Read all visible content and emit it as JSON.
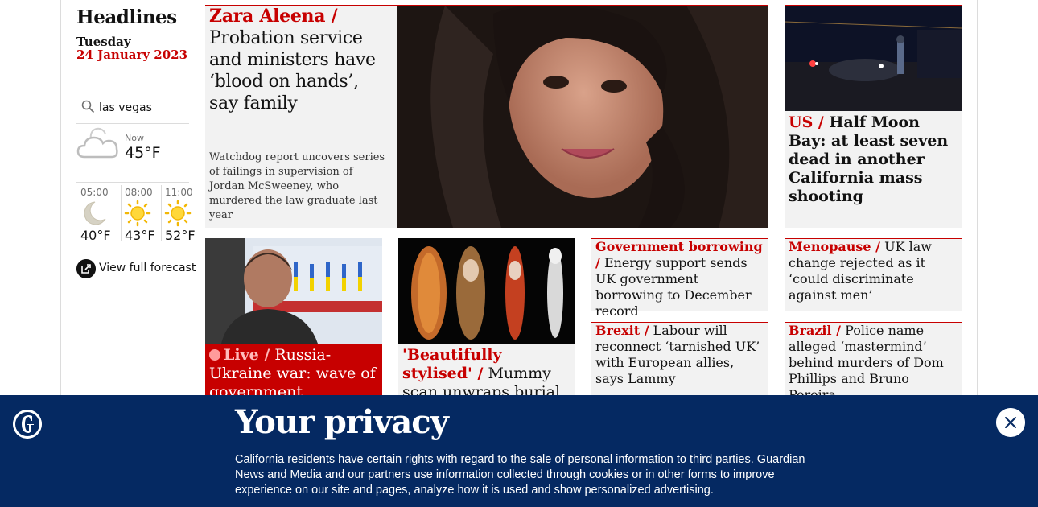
{
  "sidebar": {
    "section_title": "Headlines",
    "day": "Tuesday",
    "date": "24 January 2023",
    "search_value": "las vegas",
    "weather_now_label": "Now",
    "weather_now_temp": "45°F",
    "forecast": [
      {
        "time": "05:00",
        "temp": "40°F",
        "icon": "moon-icon"
      },
      {
        "time": "08:00",
        "temp": "43°F",
        "icon": "sun-icon"
      },
      {
        "time": "11:00",
        "temp": "52°F",
        "icon": "sun-icon"
      }
    ],
    "view_forecast": "View full forecast"
  },
  "lead": {
    "kicker": "Zara Aleena /",
    "headline": "Probation service and ministers have ‘blood on hands’, say family",
    "standfirst": "Watchdog report uncovers series of failings in supervision of Jordan McSweeney, who murdered the law graduate last year"
  },
  "stories": {
    "us": {
      "kicker": "US /",
      "headline": "Half Moon Bay: at least seven dead in another California mass shooting"
    },
    "ukraine": {
      "live": "Live /",
      "headline": "Russia-Ukraine war: wave of government"
    },
    "mummy": {
      "kicker": "'Beautifully stylised' /",
      "headline": "Mummy scan unwraps burial secrets of"
    },
    "borrowing": {
      "kicker": "Government borrowing /",
      "headline": "Energy support sends UK government borrowing to December record"
    },
    "brexit": {
      "kicker": "Brexit /",
      "headline": "Labour will reconnect ‘tarnished UK’ with European allies, says Lammy"
    },
    "menopause": {
      "kicker": "Menopause /",
      "headline": "UK law change rejected as it ‘could discriminate against men’"
    },
    "brazil": {
      "kicker": "Brazil  /",
      "headline": "Police name alleged ‘mastermind’ behind murders of Dom Phillips and Bruno Pereira"
    }
  },
  "privacy": {
    "title": "Your privacy",
    "body": "California residents have certain rights with regard to the sale of personal information to third parties. Guardian News and Media and our partners use information collected through cookies or in other forms to improve experience on our site and pages, analyze how it is used and show personalized advertising."
  },
  "colors": {
    "accent": "#c70000",
    "banner": "#052962",
    "card": "#f2f2f2"
  }
}
